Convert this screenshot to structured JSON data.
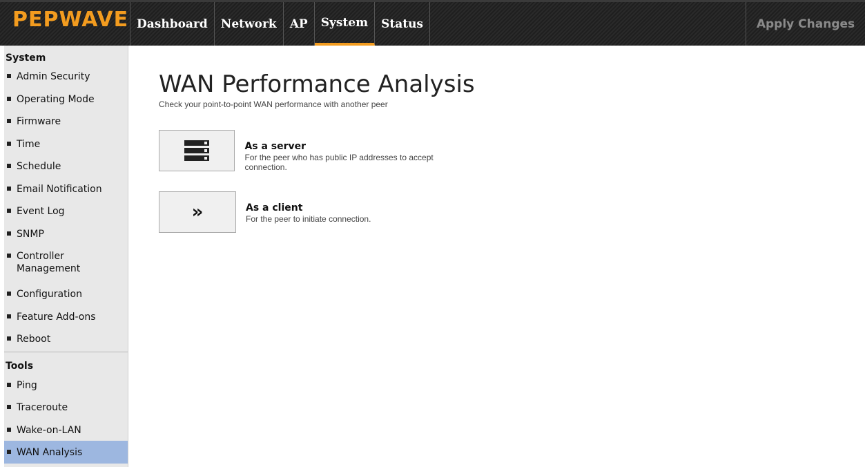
{
  "header": {
    "logo": "PEPWAVE",
    "tabs": [
      {
        "label": "Dashboard"
      },
      {
        "label": "Network"
      },
      {
        "label": "AP"
      },
      {
        "label": "System"
      },
      {
        "label": "Status"
      }
    ],
    "active_tab": "System",
    "apply_label": "Apply Changes"
  },
  "sidebar": {
    "system_title": "System",
    "system_items": [
      {
        "label": "Admin Security"
      },
      {
        "label": "Operating Mode"
      },
      {
        "label": "Firmware"
      },
      {
        "label": "Time"
      },
      {
        "label": "Schedule"
      },
      {
        "label": "Email Notification"
      },
      {
        "label": "Event Log"
      },
      {
        "label": "SNMP"
      },
      {
        "label": "Controller Management"
      },
      {
        "label": "Configuration"
      },
      {
        "label": "Feature Add-ons"
      },
      {
        "label": "Reboot"
      }
    ],
    "tools_title": "Tools",
    "tools_items": [
      {
        "label": "Ping"
      },
      {
        "label": "Traceroute"
      },
      {
        "label": "Wake-on-LAN"
      },
      {
        "label": "WAN Analysis"
      }
    ],
    "active_item": "WAN Analysis"
  },
  "main": {
    "title": "WAN Performance Analysis",
    "subtitle": "Check your point-to-point WAN performance with another peer",
    "options": [
      {
        "icon": "server-icon",
        "title": "As a server",
        "description": "For the peer who has public IP addresses to accept connection."
      },
      {
        "icon": "double-chevron-right-icon",
        "title": "As a client",
        "description": "For the peer to initiate connection."
      }
    ]
  },
  "colors": {
    "brand_orange": "#f39c1f",
    "active_sidebar": "#9db7e0",
    "sidebar_bg": "#e8e8e8"
  }
}
